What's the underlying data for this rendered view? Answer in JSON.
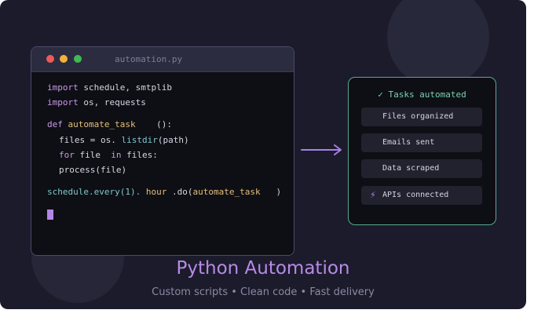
{
  "editor": {
    "filename": "automation.py",
    "lines": [
      {
        "kw": "import",
        "rest": " schedule, smtplib"
      },
      {
        "kw": "import",
        "rest": " os, requests"
      },
      {
        "kw": "def",
        "fn": "automate_task",
        "rest": "():"
      },
      {
        "pre": "files = os. ",
        "call": "listdir",
        "rest": "(path)"
      },
      {
        "kw1": "for",
        "mid": " file ",
        "kw2": "in",
        "rest": " files:"
      },
      {
        "text": "process(file)"
      },
      {
        "call": "schedule.every(1). ",
        "fn": "hour",
        "mid": " .do(",
        "call2": "automate_task",
        "rest": ")"
      }
    ]
  },
  "tasks": {
    "header": "✓ Tasks automated",
    "items": [
      {
        "label": "Files organized",
        "icon": ""
      },
      {
        "label": "Emails sent",
        "icon": ""
      },
      {
        "label": "Data scraped",
        "icon": ""
      },
      {
        "label": "APIs connected",
        "icon": "⚡"
      }
    ]
  },
  "title": "Python Automation",
  "subtitle": "Custom scripts • Clean code • Fast delivery",
  "colors": {
    "background": "#1b1b2c",
    "accent_purple": "#b98ae6",
    "accent_green": "#79d2ad",
    "panel_border": "#57a98c"
  }
}
